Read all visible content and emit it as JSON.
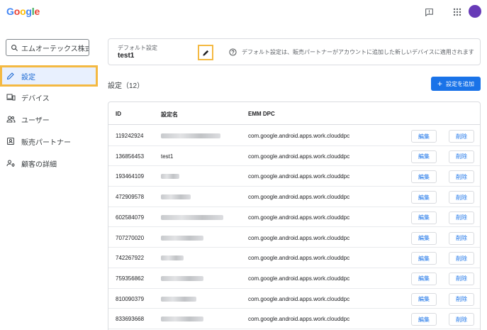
{
  "header": {
    "logo": {
      "g1": "G",
      "o1": "o",
      "o2": "o",
      "g2": "g",
      "l": "l",
      "e": "e"
    }
  },
  "sidebar": {
    "search_value": "エムオーテックス株式",
    "items": [
      {
        "label": "設定",
        "icon": "pencil-icon"
      },
      {
        "label": "デバイス",
        "icon": "devices-icon"
      },
      {
        "label": "ユーザー",
        "icon": "people-icon"
      },
      {
        "label": "販売パートナー",
        "icon": "partner-icon"
      },
      {
        "label": "顧客の詳細",
        "icon": "customer-details-icon"
      }
    ]
  },
  "default_card": {
    "label": "デフォルト設定",
    "value": "test1",
    "info": "デフォルト設定は、販売パートナーがアカウントに追加した新しいデバイスに適用されます"
  },
  "section": {
    "title": "設定（12）",
    "add_button": "設定を追加"
  },
  "table": {
    "headers": {
      "id": "ID",
      "name": "設定名",
      "dpc": "EMM DPC"
    },
    "edit_label": "編集",
    "delete_label": "削除",
    "rows": [
      {
        "id": "119242924",
        "name": "",
        "dpc": "com.google.android.apps.work.clouddpc"
      },
      {
        "id": "136856453",
        "name": "test1",
        "dpc": "com.google.android.apps.work.clouddpc"
      },
      {
        "id": "193464109",
        "name": "",
        "dpc": "com.google.android.apps.work.clouddpc"
      },
      {
        "id": "472909578",
        "name": "",
        "dpc": "com.google.android.apps.work.clouddpc"
      },
      {
        "id": "602584079",
        "name": "",
        "dpc": "com.google.android.apps.work.clouddpc"
      },
      {
        "id": "707270020",
        "name": "",
        "dpc": "com.google.android.apps.work.clouddpc"
      },
      {
        "id": "742267922",
        "name": "",
        "dpc": "com.google.android.apps.work.clouddpc"
      },
      {
        "id": "759356862",
        "name": "",
        "dpc": "com.google.android.apps.work.clouddpc"
      },
      {
        "id": "810090379",
        "name": "",
        "dpc": "com.google.android.apps.work.clouddpc"
      },
      {
        "id": "833693668",
        "name": "",
        "dpc": "com.google.android.apps.work.clouddpc"
      }
    ]
  },
  "colors": {
    "accent": "#1a73e8",
    "highlight": "#f4b942",
    "active_bg": "#e8f0fe",
    "avatar": "#673ab7"
  }
}
